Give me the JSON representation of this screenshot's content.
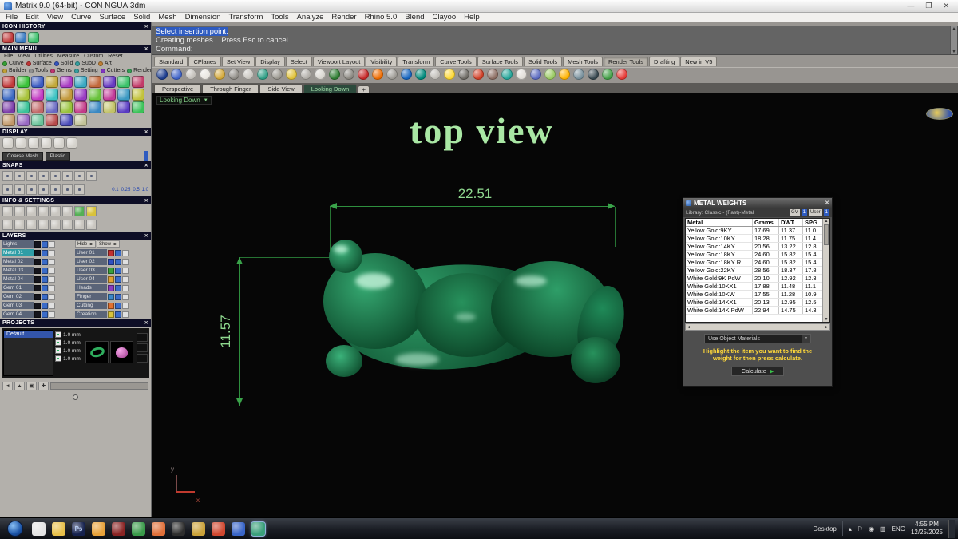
{
  "window": {
    "title": "Matrix 9.0 (64-bit) - CON NGUA.3dm"
  },
  "menu_items": [
    "File",
    "Edit",
    "View",
    "Curve",
    "Surface",
    "Solid",
    "Mesh",
    "Dimension",
    "Transform",
    "Tools",
    "Analyze",
    "Render",
    "Rhino 5.0",
    "Blend",
    "Clayoo",
    "Help"
  ],
  "command": {
    "history1": "Select insertion point:",
    "history2": "Creating meshes... Press Esc to cancel",
    "prompt": "Command:"
  },
  "ribbon_tabs": [
    {
      "label": "Standard"
    },
    {
      "label": "CPlanes"
    },
    {
      "label": "Set View"
    },
    {
      "label": "Display"
    },
    {
      "label": "Select"
    },
    {
      "label": "Viewport Layout"
    },
    {
      "label": "Visibility"
    },
    {
      "label": "Transform"
    },
    {
      "label": "Curve Tools"
    },
    {
      "label": "Surface Tools"
    },
    {
      "label": "Solid Tools"
    },
    {
      "label": "Mesh Tools"
    },
    {
      "label": "Render Tools",
      "active": true
    },
    {
      "label": "Drafting"
    },
    {
      "label": "New in V5"
    }
  ],
  "toolbar_icons": [
    "#1d3d8f",
    "#3f63c8",
    "#c2bfb9",
    "#e8e5df",
    "#d4a93a",
    "#8f8c86",
    "#c8c5bf",
    "#2f9e85",
    "#9a978f",
    "#e0c23a",
    "#b0ada7",
    "#d8d5cf",
    "#2e7d32",
    "#8a8780",
    "#c62828",
    "#ef6c00",
    "#9e9b95",
    "#1565c0",
    "#00897b",
    "#c0bdb7",
    "#fdd835",
    "#6d6a64",
    "#d04028",
    "#8d6e63",
    "#26a69a",
    "#e0ddd7",
    "#5c6bc0",
    "#9ccc65",
    "#ffb300",
    "#78909c",
    "#37474f",
    "#43a047",
    "#e53935"
  ],
  "viewport_tabs": [
    {
      "label": "Perspective"
    },
    {
      "label": "Through Finger"
    },
    {
      "label": "Side View"
    },
    {
      "label": "Looking Down",
      "active": true
    }
  ],
  "viewport": {
    "label": "Looking Down",
    "annotation": "top view",
    "dim_horizontal": "22.51",
    "dim_vertical": "11.57"
  },
  "panels": {
    "icon_history": {
      "title": "ICON HISTORY",
      "icons": [
        "#c03a3a",
        "#3a7ac0",
        "#3ac06a"
      ]
    },
    "main_menu": {
      "title": "MAIN MENU",
      "row1": [
        "File",
        "View",
        "Utilities",
        "Measure",
        "Custom",
        "Reset"
      ],
      "row2": [
        {
          "label": "Curve",
          "dot": "#35a035"
        },
        {
          "label": "Surface",
          "dot": "#c03535"
        },
        {
          "label": "Solid",
          "dot": "#3555c0"
        },
        {
          "label": "SubD",
          "dot": "#35a0a0"
        },
        {
          "label": "Art",
          "dot": "#c08035"
        }
      ],
      "row3": [
        {
          "label": "Builder",
          "dot": "#c0a035"
        },
        {
          "label": "Tools",
          "dot": "#909090"
        },
        {
          "label": "Gems",
          "dot": "#c03570"
        },
        {
          "label": "Setting",
          "dot": "#35a0a0"
        },
        {
          "label": "Cutters",
          "dot": "#8035c0"
        },
        {
          "label": "Render",
          "dot": "#35a055"
        }
      ],
      "grid": [
        "#c23a3a",
        "#3ac23a",
        "#3a5ac2",
        "#c2a83a",
        "#a83ac2",
        "#3aa8c2",
        "#c2683a",
        "#683ac2",
        "#3ac268",
        "#c23a68",
        "#3a68c2",
        "#a8c23a",
        "#c23ac2",
        "#3ac2c2",
        "#c2983a",
        "#983ac2",
        "#68c23a",
        "#c23a98",
        "#3a98c2",
        "#c2c23a",
        "#7a3aa8",
        "#3ac298",
        "#c26868",
        "#6868c2",
        "#98c23a",
        "#c23a88",
        "#3a88c2",
        "#c2c268",
        "#583ac2",
        "#3ac258",
        "#c29868",
        "#9868c2",
        "#68c298",
        "#b84a4a",
        "#4a4ab8",
        "#c2c298"
      ]
    },
    "display": {
      "title": "DISPLAY",
      "icons": [
        "#d4d1cb",
        "#d4d1cb",
        "#d4d1cb",
        "#d4d1cb",
        "#d4d1cb",
        "#d4d1cb"
      ],
      "buttons": [
        "Coarse Mesh",
        "Plastic"
      ]
    },
    "snaps": {
      "title": "SNAPS",
      "row1": [
        "#c9c6c0",
        "#c9c6c0",
        "#c9c6c0",
        "#c9c6c0",
        "#c9c6c0",
        "#c9c6c0",
        "#c9c6c0",
        "#c9c6c0"
      ],
      "row2": [
        "#c9c6c0",
        "#c9c6c0",
        "#c9c6c0",
        "#c9c6c0",
        "#c9c6c0",
        "#c9c6c0",
        "#c9c6c0"
      ],
      "values": [
        "0.1",
        "0.25",
        "0.5",
        "1.0"
      ]
    },
    "info": {
      "title": "INFO & SETTINGS",
      "row1": [
        "#c9c6c0",
        "#c9c6c0",
        "#c9c6c0",
        "#c9c6c0",
        "#c9c6c0",
        "#c9c6c0",
        "#54b054",
        "#d8c23a"
      ],
      "row2": [
        "#c9c6c0",
        "#c9c6c0",
        "#c9c6c0",
        "#c9c6c0",
        "#c9c6c0",
        "#c9c6c0",
        "#c9c6c0",
        "#c9c6c0"
      ]
    },
    "layers": {
      "title": "LAYERS",
      "lights_label": "Lights",
      "hide_label": "Hide",
      "show_label": "Show",
      "rows": [
        {
          "left": "Metal 01",
          "right": "User 01",
          "rc": "#c03030",
          "active": true
        },
        {
          "left": "Metal 02",
          "right": "User 02",
          "rc": "#3050c0"
        },
        {
          "left": "Metal 03",
          "right": "User 03",
          "rc": "#3aa03a"
        },
        {
          "left": "Metal 04",
          "right": "User 04",
          "rc": "#e0a030"
        },
        {
          "left": "Gem 01",
          "right": "Heads",
          "rc": "#8a3ac0"
        },
        {
          "left": "Gem 02",
          "right": "Finger",
          "rc": "#3a86c8"
        },
        {
          "left": "Gem 03",
          "right": "Cutting",
          "rc": "#e07030"
        },
        {
          "left": "Gem 04",
          "right": "Creation",
          "rc": "#d8c23a"
        }
      ]
    },
    "projects": {
      "title": "PROJECTS",
      "items": [
        {
          "label": "Default",
          "active": true
        }
      ],
      "sizes": [
        "1.0 mm",
        "1.0 mm",
        "1.0 mm",
        "1.0 mm"
      ]
    }
  },
  "metal_weights": {
    "title": "METAL WEIGHTS",
    "library": "Library: Classic - (Fast)-Metal",
    "gv_label": "GV",
    "gv_value": "1",
    "user_label": "User",
    "user_value": "1",
    "columns": [
      "Metal",
      "Grams",
      "DWT",
      "SPG"
    ],
    "rows": [
      [
        "Yellow Gold:9KY",
        "17.69",
        "11.37",
        "11.0"
      ],
      [
        "Yellow Gold:10KY",
        "18.28",
        "11.75",
        "11.4"
      ],
      [
        "Yellow Gold:14KY",
        "20.56",
        "13.22",
        "12.8"
      ],
      [
        "Yellow Gold:18KY",
        "24.60",
        "15.82",
        "15.4"
      ],
      [
        "Yellow Gold:18KY R...",
        "24.60",
        "15.82",
        "15.4"
      ],
      [
        "Yellow Gold:22KY",
        "28.56",
        "18.37",
        "17.8"
      ],
      [
        "White Gold:9K PdW",
        "20.10",
        "12.92",
        "12.3"
      ],
      [
        "White Gold:10KX1",
        "17.88",
        "11.48",
        "11.1"
      ],
      [
        "White Gold:10KW",
        "17.55",
        "11.28",
        "10.9"
      ],
      [
        "White Gold:14KX1",
        "20.13",
        "12.95",
        "12.5"
      ],
      [
        "White Gold:14K PdW",
        "22.94",
        "14.75",
        "14.3"
      ]
    ],
    "dropdown": "Use Object Materials",
    "hint": "Highlight the item you want to find the weight for then press calculate.",
    "calculate_label": "Calculate"
  },
  "taskbar": {
    "icons": [
      {
        "bg": "#e4e4e4",
        "label": ""
      },
      {
        "bg": "#e8c04a",
        "label": ""
      },
      {
        "bg": "#16224e",
        "label": "Ps"
      },
      {
        "bg": "#e8a23a",
        "label": ""
      },
      {
        "bg": "#8a2424",
        "label": ""
      },
      {
        "bg": "#3a9a4a",
        "label": ""
      },
      {
        "bg": "#e0703a",
        "label": ""
      },
      {
        "bg": "#2e2e2e",
        "label": ""
      },
      {
        "bg": "#caa23a",
        "label": ""
      },
      {
        "bg": "#d04830",
        "label": ""
      },
      {
        "bg": "#3a66c8",
        "label": ""
      },
      {
        "bg": "#3aa07a",
        "label": "",
        "active": true
      }
    ],
    "desktop_label": "Desktop",
    "language": "ENG",
    "time": "4:55 PM",
    "date": "12/25/2025"
  }
}
